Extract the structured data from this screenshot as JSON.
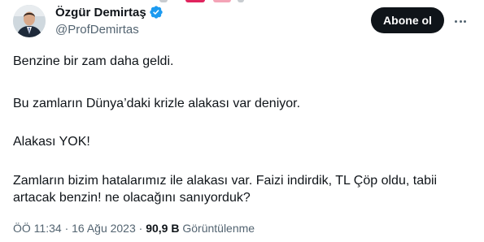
{
  "author": {
    "display_name": "Özgür Demirtaş",
    "handle": "@ProfDemirtas",
    "verified": true
  },
  "actions": {
    "follow_label": "Abone ol",
    "more_icon": "ellipsis-icon"
  },
  "tweet": {
    "paragraphs": [
      "Benzine bir zam daha geldi.",
      "Bu zamların Dünya’daki krizle alakası var deniyor.",
      "Alakası YOK!",
      "Zamların bizim hatalarımız ile alakası var. Faizi indirdik, TL Çöp oldu, tabii artacak benzin! ne olacağını sanıyorduk?"
    ]
  },
  "meta": {
    "time": "ÖÖ 11:34",
    "separator": "·",
    "date": "16 Ağu 2023",
    "views_count": "90,9 B",
    "views_label": "Görüntülenme"
  },
  "colors": {
    "text": "#0f1419",
    "secondary": "#536471",
    "verified_badge": "#1d9bf0",
    "button_bg": "#0f1419"
  }
}
